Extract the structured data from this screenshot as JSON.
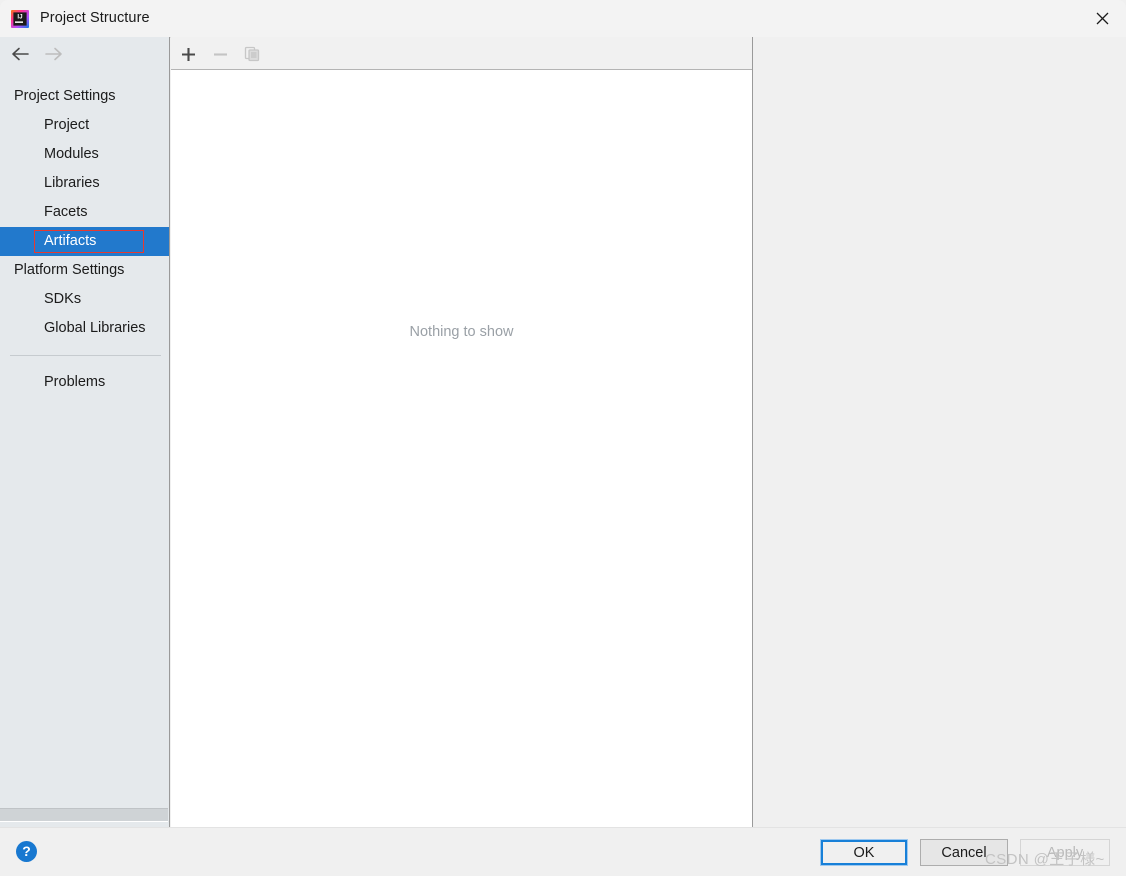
{
  "window": {
    "title": "Project Structure",
    "icon": "intellij-idea-icon",
    "close_label": "✕"
  },
  "nav": {
    "back_icon": "arrow-left-icon",
    "forward_icon": "arrow-right-icon"
  },
  "sidebar": {
    "sections": [
      {
        "label": "Project Settings",
        "type": "group",
        "items": [
          {
            "label": "Project",
            "selected": false
          },
          {
            "label": "Modules",
            "selected": false
          },
          {
            "label": "Libraries",
            "selected": false
          },
          {
            "label": "Facets",
            "selected": false
          },
          {
            "label": "Artifacts",
            "selected": true,
            "annotated": true
          }
        ]
      },
      {
        "label": "Platform Settings",
        "type": "group",
        "items": [
          {
            "label": "SDKs",
            "selected": false
          },
          {
            "label": "Global Libraries",
            "selected": false
          }
        ]
      }
    ],
    "footer_items": [
      {
        "label": "Problems",
        "selected": false
      }
    ],
    "selection_color": "#2279cc",
    "annotation_color": "#e8392f"
  },
  "toolbar": {
    "add_icon": "plus-icon",
    "remove_icon": "minus-icon",
    "copy_icon": "copy-icon",
    "add_enabled": true,
    "remove_enabled": false,
    "copy_enabled": false
  },
  "content": {
    "empty_message": "Nothing to show"
  },
  "footer": {
    "help_label": "?",
    "ok_label": "OK",
    "cancel_label": "Cancel",
    "apply_label": "Apply",
    "apply_enabled": false
  },
  "watermark": {
    "text": "CSDN @王子様~"
  }
}
